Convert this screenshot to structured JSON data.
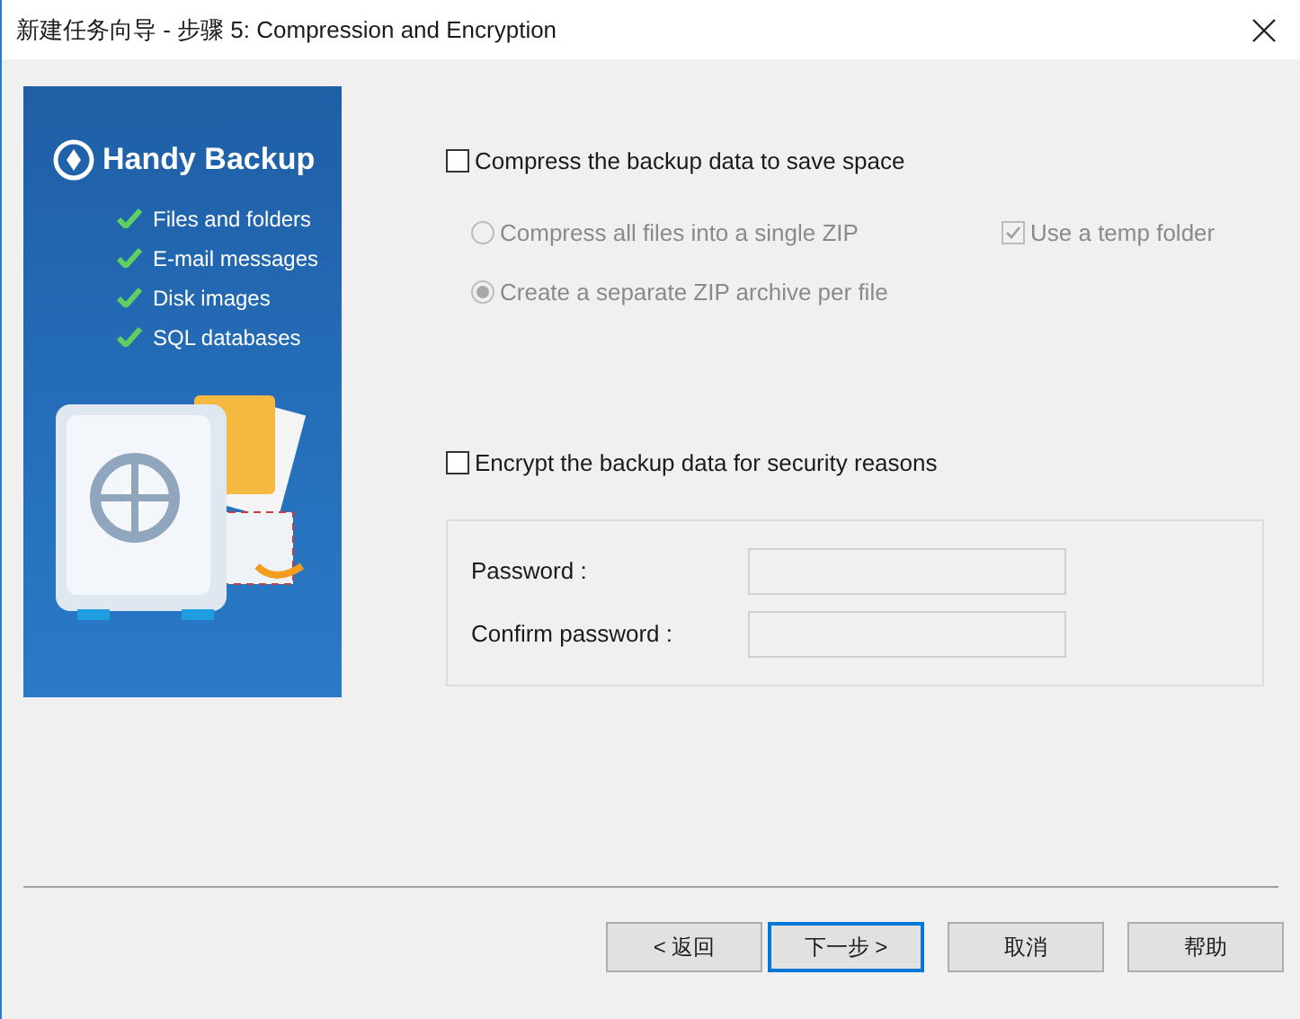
{
  "window": {
    "title": "新建任务向导 - 步骤 5: Compression and Encryption"
  },
  "banner": {
    "logo": "Handy Backup",
    "features": [
      "Files and folders",
      "E-mail messages",
      "Disk images",
      "SQL databases"
    ]
  },
  "compression": {
    "option": {
      "label": "Compress the backup data to save space",
      "checked": false
    },
    "modes": [
      {
        "label": "Compress all files into a single ZIP",
        "selected": false,
        "disabled": true
      },
      {
        "label": "Create a separate ZIP archive per file",
        "selected": true,
        "disabled": true
      }
    ],
    "temp_folder": {
      "label": "Use a temp folder",
      "checked": true,
      "disabled": true
    }
  },
  "encryption": {
    "option": {
      "label": "Encrypt the backup data for security reasons",
      "checked": false
    },
    "fields": [
      {
        "label": "Password :",
        "disabled": true
      },
      {
        "label": "Confirm password :",
        "disabled": true
      }
    ]
  },
  "buttons": [
    {
      "label": "< 返回",
      "focused": false
    },
    {
      "label": "下一步 >",
      "focused": true
    },
    {
      "label": "取消",
      "focused": false
    },
    {
      "label": "帮助",
      "focused": false
    }
  ]
}
